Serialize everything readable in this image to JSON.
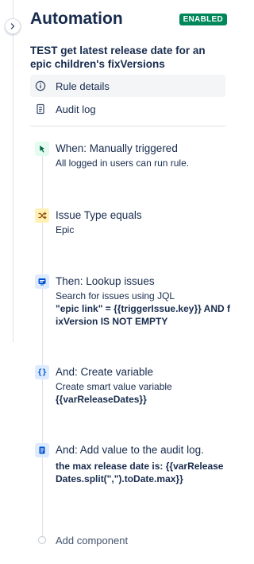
{
  "header": {
    "title": "Automation",
    "status_badge": "ENABLED"
  },
  "rule": {
    "name": "TEST get latest release date for an epic children's fixVersions"
  },
  "nav": {
    "rule_details": "Rule details",
    "audit_log": "Audit log"
  },
  "steps": [
    {
      "icon": "cursor-click-icon",
      "title": "When: Manually triggered",
      "desc": "All logged in users can run rule.",
      "code": ""
    },
    {
      "icon": "shuffle-icon",
      "title": "Issue Type equals",
      "desc": "Epic",
      "code": ""
    },
    {
      "icon": "lookup-icon",
      "title": "Then: Lookup issues",
      "desc": "Search for issues using JQL",
      "code": "\"epic link\" = {{triggerIssue.key}} AND fixVersion IS NOT EMPTY"
    },
    {
      "icon": "curly-braces-icon",
      "title": "And: Create variable",
      "desc": "Create smart value variable",
      "code": "{{varReleaseDates}}"
    },
    {
      "icon": "document-icon",
      "title": "And: Add value to the audit log.",
      "desc": "",
      "code": "the max release date is: {{varReleaseDates.split(\",\").toDate.max}}"
    }
  ],
  "add_component": "Add component",
  "colors": {
    "badge_green": "#00875a",
    "text_primary": "#172b4d",
    "trigger_bg": "#e3fcef",
    "condition_bg": "#fff0b3",
    "action_bg": "#deebff"
  }
}
